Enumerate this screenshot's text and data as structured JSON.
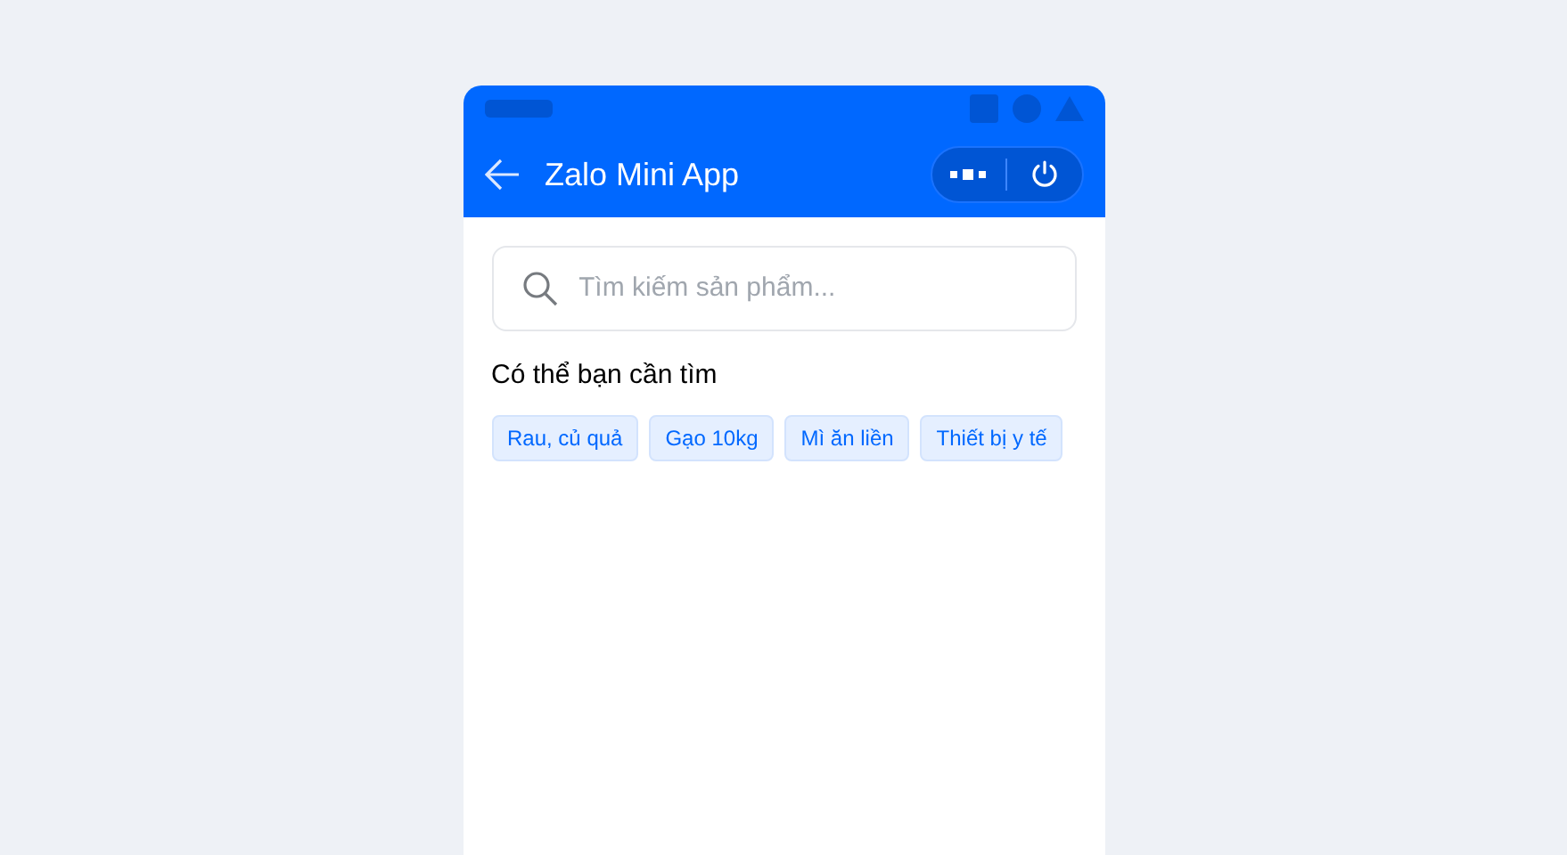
{
  "header": {
    "title": "Zalo Mini App"
  },
  "search": {
    "placeholder": "Tìm kiếm sản phẩm..."
  },
  "suggestions": {
    "title": "Có thể bạn cần tìm",
    "tags": [
      "Rau, củ quả",
      "Gạo 10kg",
      "Mì ăn liền",
      "Thiết bị y tế"
    ]
  }
}
